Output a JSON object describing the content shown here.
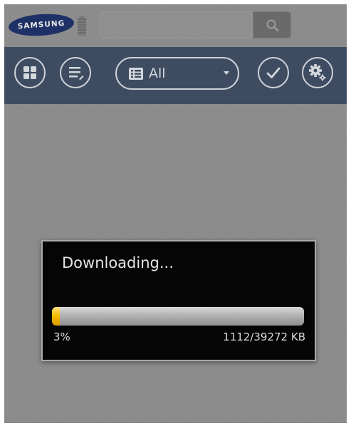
{
  "header": {
    "brand": "SAMSUNG",
    "search": {
      "value": "",
      "placeholder": ""
    },
    "icons": {
      "search": "search-icon",
      "battery": "battery-icon"
    }
  },
  "toolbar": {
    "buttons": [
      {
        "name": "grid-view",
        "icon": "grid-icon"
      },
      {
        "name": "list-view",
        "icon": "list-edit-icon"
      },
      {
        "name": "select-all",
        "icon": "check-icon"
      },
      {
        "name": "settings",
        "icon": "gear-icon"
      }
    ],
    "filter": {
      "selected": "All",
      "icon": "list-icon"
    }
  },
  "dialog": {
    "title": "Downloading...",
    "progress": {
      "percent_label": "3%",
      "fraction": 0.03,
      "size_label": "1112/39272 KB"
    }
  },
  "colors": {
    "toolbar_bg": "#3e4c62",
    "progress_fill": "#f4b800",
    "dialog_bg": "#050505",
    "overlay_bg": "#8a8a8a"
  }
}
